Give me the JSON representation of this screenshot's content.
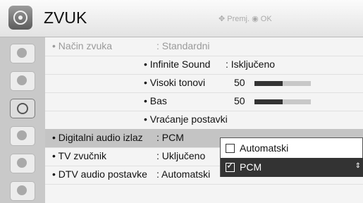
{
  "header": {
    "title": "ZVUK",
    "hint_move_icon": "✥",
    "hint_move_label": "Premj.",
    "hint_ok_icon": "◉",
    "hint_ok_label": "OK"
  },
  "sidebar": {
    "items": [
      {
        "icon": "picture-icon"
      },
      {
        "icon": "screen-icon"
      },
      {
        "icon": "audio-icon",
        "active": true
      },
      {
        "icon": "clock-icon"
      },
      {
        "icon": "lock-icon"
      },
      {
        "icon": "option-icon"
      }
    ]
  },
  "rows": {
    "mode": {
      "label": "• Način zvuka",
      "value": ": Standardni"
    },
    "infinite": {
      "label": "• Infinite Sound",
      "value": ": Isključeno"
    },
    "treble": {
      "label": "• Visoki tonovi",
      "value": "50",
      "level": 0.5
    },
    "bass": {
      "label": "• Bas",
      "value": "50",
      "level": 0.5
    },
    "reset": {
      "label": "• Vraćanje postavki"
    },
    "digital": {
      "label": "• Digitalni audio izlaz",
      "value": ": PCM"
    },
    "speaker": {
      "label": "• TV zvučnik",
      "value": ": Uključeno"
    },
    "dtv": {
      "label": "• DTV audio postavke",
      "value": ": Automatski"
    }
  },
  "popup": {
    "options": [
      {
        "label": "Automatski",
        "checked": false
      },
      {
        "label": "PCM",
        "checked": true
      }
    ],
    "check_glyph": "✓",
    "scroll_glyph": "⇕"
  },
  "colors": {
    "selected_row": "#c4c4c4",
    "popup_selected": "#333333"
  }
}
